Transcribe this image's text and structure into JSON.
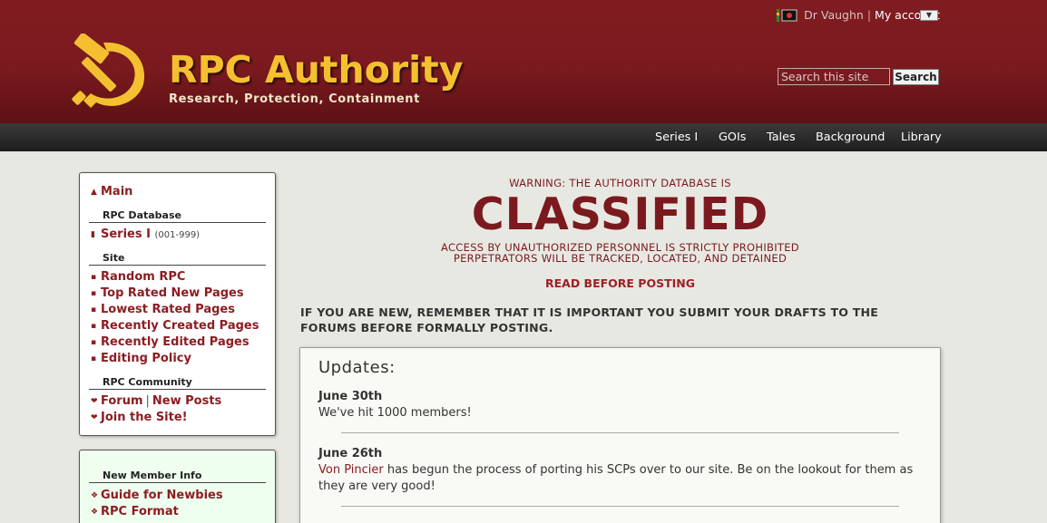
{
  "header": {
    "title": "RPC Authority",
    "subtitle": "Research, Protection, Containment",
    "username": "Dr Vaughn",
    "separator": "|",
    "my_account": "My account",
    "dropdown_glyph": "▼",
    "search_placeholder": "Search this site",
    "search_button": "Search"
  },
  "topnav": [
    "Series I",
    "GOIs",
    "Tales",
    "Background",
    "Library"
  ],
  "sidebar": {
    "main": "Main",
    "rpc_database_heading": "RPC Database",
    "series_link": "Series I",
    "series_note": "(001-999)",
    "site_heading": "Site",
    "site_links": [
      "Random RPC",
      "Top Rated New Pages",
      "Lowest Rated Pages",
      "Recently Created Pages",
      "Recently Edited Pages",
      "Editing Policy"
    ],
    "community_heading": "RPC Community",
    "forum": "Forum",
    "sep": "|",
    "new_posts": "New Posts",
    "join": "Join the Site!",
    "newmember_heading": "New Member Info",
    "newmember_links": [
      "Guide for Newbies",
      "RPC Format"
    ]
  },
  "main": {
    "warning_line": "WARNING: THE AUTHORITY DATABASE IS",
    "classified": "CLASSIFIED",
    "access_line1": "ACCESS BY UNAUTHORIZED PERSONNEL IS STRICTLY PROHIBITED",
    "access_line2": "PERPETRATORS WILL BE TRACKED, LOCATED, AND DETAINED",
    "read_before": "READ BEFORE POSTING",
    "new_notice": "IF YOU ARE NEW, REMEMBER THAT IT IS IMPORTANT YOU SUBMIT YOUR DRAFTS TO THE FORUMS BEFORE FORMALLY POSTING.",
    "updates_title": "Updates:",
    "updates": [
      {
        "date": "June 30th",
        "text": "We've hit 1000 members!"
      },
      {
        "date": "June 26th",
        "link": "Von Pincier",
        "text": " has begun the process of porting his SCPs over to our site. Be on the lookout for them as they are very good!"
      }
    ]
  },
  "colors": {
    "brand": "#7a1a1f",
    "gold": "#f4c030",
    "link": "#8c1d22"
  },
  "icons": [
    "hammer-sickle-logo",
    "user-status-icon",
    "home-icon",
    "page-icon",
    "square-bullet",
    "speech-bubble-icon",
    "diamond-bullet"
  ]
}
